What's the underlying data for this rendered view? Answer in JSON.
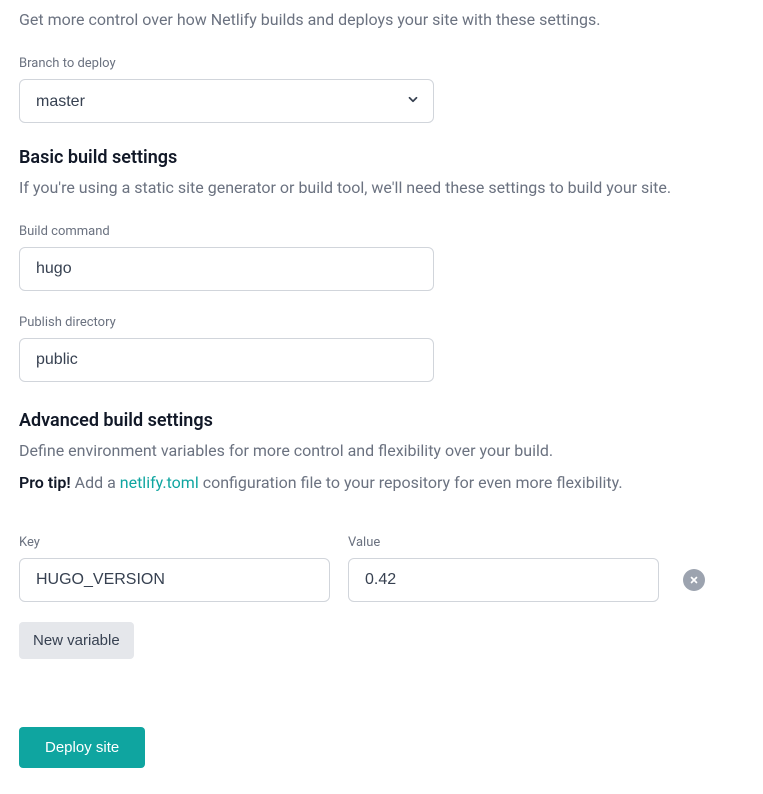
{
  "intro": "Get more control over how Netlify builds and deploys your site with these settings.",
  "branch": {
    "label": "Branch to deploy",
    "value": "master"
  },
  "basic": {
    "heading": "Basic build settings",
    "desc": "If you're using a static site generator or build tool, we'll need these settings to build your site.",
    "build_command": {
      "label": "Build command",
      "value": "hugo"
    },
    "publish_directory": {
      "label": "Publish directory",
      "value": "public"
    }
  },
  "advanced": {
    "heading": "Advanced build settings",
    "desc": "Define environment variables for more control and flexibility over your build.",
    "pro_tip_strong": "Pro tip!",
    "pro_tip_before": " Add a ",
    "pro_tip_link": "netlify.toml",
    "pro_tip_after": " configuration file to your repository for even more flexibility.",
    "key_label": "Key",
    "value_label": "Value",
    "vars": [
      {
        "key": "HUGO_VERSION",
        "value": "0.42"
      }
    ],
    "new_variable_label": "New variable"
  },
  "deploy_label": "Deploy site"
}
